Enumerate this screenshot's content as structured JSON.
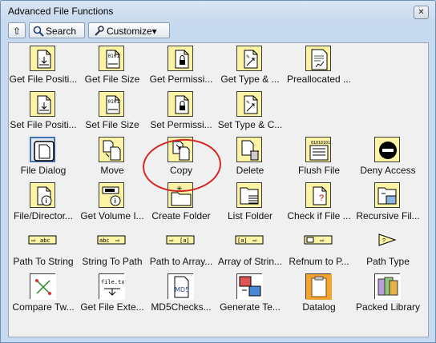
{
  "window": {
    "title": "Advanced File Functions",
    "close_glyph": "✕"
  },
  "toolbar": {
    "up_glyph": "⇧",
    "search_label": "Search",
    "customize_label": "Customize▾"
  },
  "items": [
    {
      "label": "Get File Positi...",
      "icon": "file-position-icon"
    },
    {
      "label": "Get File Size",
      "icon": "file-size-icon"
    },
    {
      "label": "Get Permissi...",
      "icon": "permissions-icon"
    },
    {
      "label": "Get Type & ...",
      "icon": "type-creator-icon"
    },
    {
      "label": "Preallocated ...",
      "icon": "preallocated-icon"
    },
    {
      "label": "Set File Positi...",
      "icon": "file-position-icon"
    },
    {
      "label": "Set File Size",
      "icon": "file-size-icon"
    },
    {
      "label": "Set Permissi...",
      "icon": "permissions-icon"
    },
    {
      "label": "Set Type & C...",
      "icon": "type-creator-icon"
    },
    {
      "label": "File Dialog",
      "icon": "file-dialog-icon"
    },
    {
      "label": "Move",
      "icon": "move-icon"
    },
    {
      "label": "Copy",
      "icon": "copy-icon"
    },
    {
      "label": "Delete",
      "icon": "delete-icon"
    },
    {
      "label": "Flush File",
      "icon": "flush-file-icon"
    },
    {
      "label": "Deny Access",
      "icon": "deny-access-icon"
    },
    {
      "label": "File/Director...",
      "icon": "file-info-icon"
    },
    {
      "label": "Get Volume I...",
      "icon": "volume-info-icon"
    },
    {
      "label": "Create Folder",
      "icon": "create-folder-icon"
    },
    {
      "label": "List Folder",
      "icon": "list-folder-icon"
    },
    {
      "label": "Check if File ...",
      "icon": "check-file-icon"
    },
    {
      "label": "Recursive Fil...",
      "icon": "recursive-file-icon"
    },
    {
      "label": "Path To String",
      "icon": "path-to-string-icon"
    },
    {
      "label": "String To Path",
      "icon": "string-to-path-icon"
    },
    {
      "label": "Path to Array...",
      "icon": "path-to-array-icon"
    },
    {
      "label": "Array of Strin...",
      "icon": "array-to-path-icon"
    },
    {
      "label": "Refnum to P...",
      "icon": "refnum-to-path-icon"
    },
    {
      "label": "Path Type",
      "icon": "path-type-icon"
    },
    {
      "label": "Compare Tw...",
      "icon": "compare-icon"
    },
    {
      "label": "Get File Exte...",
      "icon": "file-extension-icon"
    },
    {
      "label": "MD5Checks...",
      "icon": "md5-icon"
    },
    {
      "label": "Generate Te...",
      "icon": "generate-temp-icon"
    },
    {
      "label": "Datalog",
      "icon": "datalog-icon"
    },
    {
      "label": "Packed Library",
      "icon": "packed-library-icon"
    }
  ],
  "glyphs": {
    "size_bits": "0101",
    "file_ext": "file.txt",
    "md5": "MD5",
    "abc": "abc",
    "brackets": "[a]"
  }
}
